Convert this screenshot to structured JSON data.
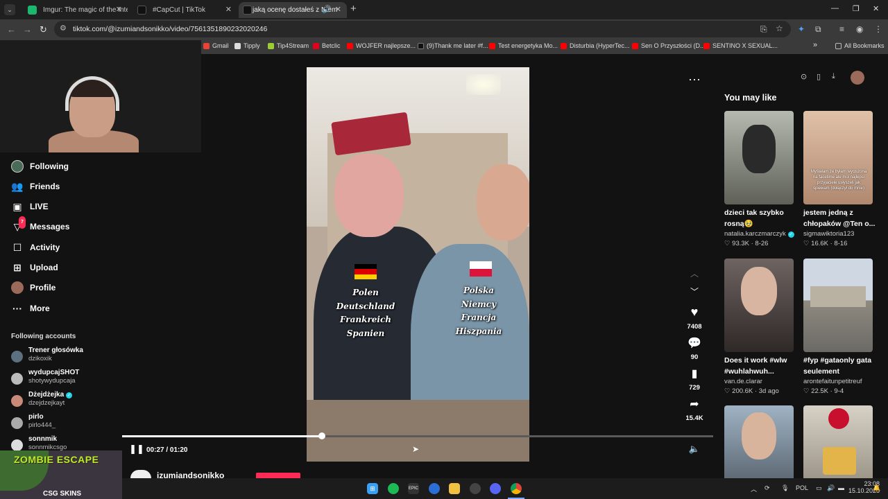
{
  "browser": {
    "tabs": [
      {
        "title": "Imgur: The magic of the Interne",
        "color": "#1bb76e"
      },
      {
        "title": "#CapCut | TikTok",
        "color": "#111111"
      },
      {
        "title": "jaką ocenę dostałeś z Niem",
        "color": "#111111"
      }
    ],
    "new_tab": "+",
    "url": "tiktok.com/@izumiandsonikko/video/7561351890232020246"
  },
  "bookmarks": {
    "items": [
      {
        "label": "Gmail",
        "color": "#ea4335"
      },
      {
        "label": "Tipply",
        "color": "#222222"
      },
      {
        "label": "Tip4Stream",
        "color": "#9acd32"
      },
      {
        "label": "Betclic",
        "color": "#e2001a"
      },
      {
        "label": "WOJFER najlepsze...",
        "color": "#ff0000"
      },
      {
        "label": "(9)Thank me later #f...",
        "color": "#111111"
      },
      {
        "label": "Test energetyka Mo...",
        "color": "#ff0000"
      },
      {
        "label": "Disturbia (HyperTec...",
        "color": "#ff0000"
      },
      {
        "label": "Sen O Przyszłości (D...",
        "color": "#ff0000"
      },
      {
        "label": "SENTINO X SEXUAL...",
        "color": "#ff0000"
      }
    ],
    "more": "»",
    "all": "All Bookmarks"
  },
  "sidebar": {
    "nav": [
      {
        "label": "Following",
        "icon": "avatar-icon"
      },
      {
        "label": "Friends",
        "icon": "friends-icon"
      },
      {
        "label": "LIVE",
        "icon": "live-icon"
      },
      {
        "label": "Messages",
        "icon": "messages-icon",
        "badge": "7"
      },
      {
        "label": "Activity",
        "icon": "activity-icon"
      },
      {
        "label": "Upload",
        "icon": "upload-icon"
      },
      {
        "label": "Profile",
        "icon": "profile-icon"
      },
      {
        "label": "More",
        "icon": "more-icon"
      }
    ],
    "following_title": "Following accounts",
    "accounts": [
      {
        "name": "Trener głosówka",
        "handle": "dzikoxik",
        "verified": false
      },
      {
        "name": "wydupcajSHOT",
        "handle": "shotywydupcaja",
        "verified": false
      },
      {
        "name": "Dżejdżejka",
        "handle": "dzejdzejkayt",
        "verified": true
      },
      {
        "name": "pirlo",
        "handle": "pirlo444_",
        "verified": false
      },
      {
        "name": "sonnmik",
        "handle": "sonnmikcsgo",
        "verified": false
      }
    ]
  },
  "stream_overlay": {
    "title": "ZOMBIE ESCAPE",
    "brand": "CSG SKINS"
  },
  "video": {
    "left_text": [
      "Polen",
      "Deutschland",
      "Frankreich",
      "Spanien"
    ],
    "right_text": [
      "Polska",
      "Niemcy",
      "Francja",
      "Hiszpania"
    ],
    "likes": "7408",
    "comments": "90",
    "saves": "729",
    "shares": "15.4K",
    "time": "00:27 / 01:20",
    "progress": 0.3375,
    "author": "izumiandsonikko"
  },
  "recommendations": {
    "title": "You may like",
    "items": [
      {
        "caption": "dzieci tak szybko rosną🥹",
        "user": "natalia.karczmarczyk",
        "verified": true,
        "stats": "♡ 93.3K · 8-26",
        "thumb": "#8c8f86"
      },
      {
        "caption": "jestem jedną z chłopaków @Ten o...",
        "user": "sigmawiktoria123",
        "verified": false,
        "stats": "♡ 16.6K · 8-16",
        "thumb": "#c9a88f"
      },
      {
        "caption": "Does it work #wlw #wuhlahwuh...",
        "user": "van.de.clarar",
        "verified": false,
        "stats": "♡ 200.6K · 3d ago",
        "thumb": "#5a5250"
      },
      {
        "caption": "#fyp #gataonly gata seulement",
        "user": "arontefaitunpetitreuf",
        "verified": false,
        "stats": "♡ 22.5K · 9-4",
        "thumb": "#8aa0b4"
      },
      {
        "caption": "",
        "user": "",
        "verified": false,
        "stats": "",
        "thumb": "#7b8a96"
      },
      {
        "caption": "",
        "user": "",
        "verified": false,
        "stats": "",
        "thumb": "#9a8f7e"
      }
    ],
    "thumb_overlays": [
      "Myślałam że byłam wyciszona na facetime ale moi najlepsi przyjaciele usłyszeli jak śpiewam (dołączył do mnie)"
    ]
  },
  "taskbar": {
    "lang": "POL",
    "time": "23:08",
    "date": "15.10.2025"
  }
}
